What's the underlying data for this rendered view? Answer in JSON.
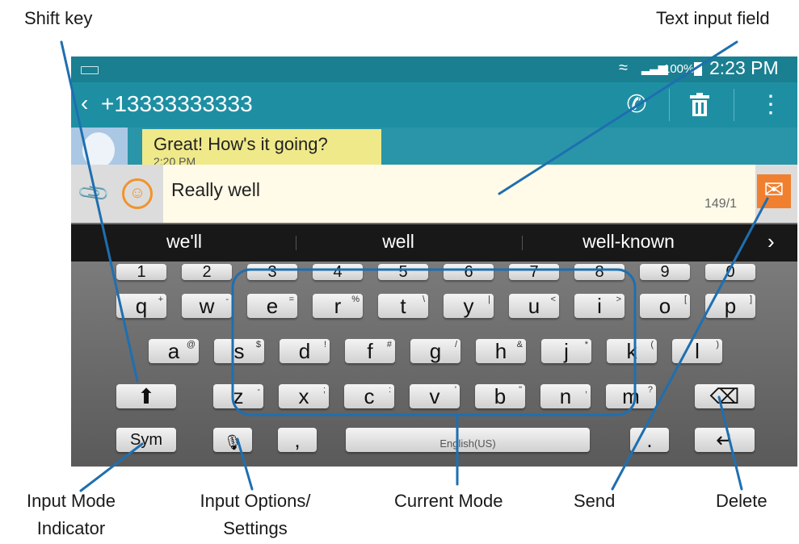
{
  "callouts": {
    "shift_key": "Shift key",
    "text_input_field": "Text input field",
    "input_mode_indicator_l1": "Input Mode",
    "input_mode_indicator_l2": "Indicator",
    "input_options_l1": "Input Options/",
    "input_options_l2": "Settings",
    "current_mode": "Current Mode",
    "send": "Send",
    "delete": "Delete"
  },
  "status_bar": {
    "battery": "100%",
    "time": "2:23 PM",
    "wifi_icon": "wifi-icon",
    "signal_icon": "signal-icon"
  },
  "action_bar": {
    "back_icon": "‹",
    "contact": "+13333333333",
    "phone_icon": "✆",
    "delete_icon": "🗑",
    "menu_icon": "⋮"
  },
  "thread": {
    "message": "Great! How's it going?",
    "time": "2:20 PM"
  },
  "composer": {
    "text": "Really well",
    "counter": "149/1",
    "send_icon": "✉"
  },
  "suggestions": {
    "words": [
      "we'll",
      "well",
      "well-known"
    ],
    "more_icon": "›"
  },
  "keyboard": {
    "numbers": [
      "1",
      "2",
      "3",
      "4",
      "5",
      "6",
      "7",
      "8",
      "9",
      "0"
    ],
    "row1": [
      {
        "k": "q",
        "s": "+"
      },
      {
        "k": "w",
        "s": "-"
      },
      {
        "k": "e",
        "s": "="
      },
      {
        "k": "r",
        "s": "%"
      },
      {
        "k": "t",
        "s": "\\"
      },
      {
        "k": "y",
        "s": "|"
      },
      {
        "k": "u",
        "s": "<"
      },
      {
        "k": "i",
        "s": ">"
      },
      {
        "k": "o",
        "s": "["
      },
      {
        "k": "p",
        "s": "]"
      }
    ],
    "row2": [
      {
        "k": "a",
        "s": "@"
      },
      {
        "k": "s",
        "s": "$"
      },
      {
        "k": "d",
        "s": "!"
      },
      {
        "k": "f",
        "s": "#"
      },
      {
        "k": "g",
        "s": "/"
      },
      {
        "k": "h",
        "s": "&"
      },
      {
        "k": "j",
        "s": "*"
      },
      {
        "k": "k",
        "s": "("
      },
      {
        "k": "l",
        "s": ")"
      }
    ],
    "row3": [
      {
        "k": "z",
        "s": "-"
      },
      {
        "k": "x",
        "s": ";"
      },
      {
        "k": "c",
        "s": ":"
      },
      {
        "k": "v",
        "s": "'"
      },
      {
        "k": "b",
        "s": "\""
      },
      {
        "k": "n",
        "s": ","
      },
      {
        "k": "m",
        "s": "?"
      }
    ],
    "shift_icon": "⬆",
    "backspace_icon": "⌫",
    "sym_label": "Sym",
    "mic_icon": "🎙",
    "comma": ",",
    "space_label": "English(US)",
    "period": ".",
    "enter_icon": "↵"
  },
  "colors": {
    "status_bar": "#1a7f91",
    "action_bar": "#1e8fa3",
    "send_button": "#f08030",
    "callout_line": "#1e6fb0"
  }
}
